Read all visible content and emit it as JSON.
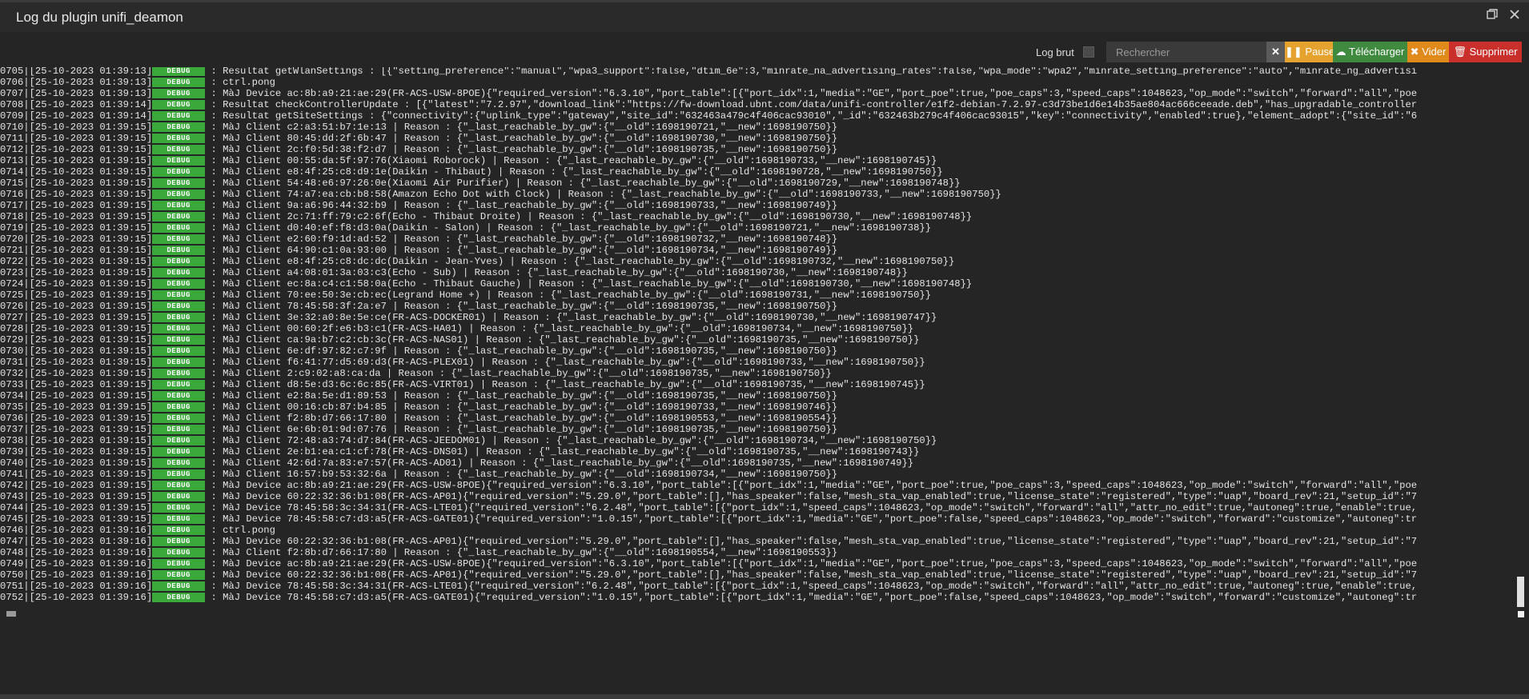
{
  "window": {
    "title": "Log du plugin unifi_deamon"
  },
  "toolbar": {
    "raw_label": "Log brut",
    "search_placeholder": "Rechercher",
    "clear_label": "✕",
    "pause_label": "Pause",
    "download_label": "Télécharger",
    "empty_label": "Vider",
    "delete_label": "Supprimer"
  },
  "colors": {
    "debug_badge": "#3ba83b",
    "pause": "#e6a22e",
    "download": "#3f8a3f",
    "empty": "#e08a1c",
    "delete": "#c9302c"
  },
  "log": {
    "lines": [
      {
        "p": "0705|[25-10-2023 01:39:13]",
        "l": "DEBUG",
        "m": " : Resultat getWlanSettings : [{\"setting_preference\":\"manual\",\"wpa3_support\":false,\"dtim_6e\":3,\"minrate_na_advertising_rates\":false,\"wpa_mode\":\"wpa2\",\"minrate_setting_preference\":\"auto\",\"minrate_ng_advertisi"
      },
      {
        "p": "0706|[25-10-2023 01:39:13]",
        "l": "DEBUG",
        "m": " : ctrl.pong"
      },
      {
        "p": "0707|[25-10-2023 01:39:13]",
        "l": "DEBUG",
        "m": " : MàJ Device ac:8b:a9:21:ae:29(FR-ACS-USW-8POE){\"required_version\":\"6.3.10\",\"port_table\":[{\"port_idx\":1,\"media\":\"GE\",\"port_poe\":true,\"poe_caps\":3,\"speed_caps\":1048623,\"op_mode\":\"switch\",\"forward\":\"all\",\"poe"
      },
      {
        "p": "0708|[25-10-2023 01:39:14]",
        "l": "DEBUG",
        "m": " : Resultat checkControllerUpdate : [{\"latest\":\"7.2.97\",\"download_link\":\"https://fw-download.ubnt.com/data/unifi-controller/e1f2-debian-7.2.97-c3d73be1d6e14b35ae804ac666ceeade.deb\",\"has_upgradable_controller"
      },
      {
        "p": "0709|[25-10-2023 01:39:14]",
        "l": "DEBUG",
        "m": " : Resultat getSiteSettings : {\"connectivity\":{\"uplink_type\":\"gateway\",\"site_id\":\"632463a479c4f406cac93010\",\"_id\":\"632463b279c4f406cac93015\",\"key\":\"connectivity\",\"enabled\":true},\"element_adopt\":{\"site_id\":\"6"
      },
      {
        "p": "0710|[25-10-2023 01:39:15]",
        "l": "DEBUG",
        "m": " : MàJ Client c2:a3:51:b7:1e:13 | Reason : {\"_last_reachable_by_gw\":{\"__old\":1698190721,\"__new\":1698190750}}"
      },
      {
        "p": "0711|[25-10-2023 01:39:15]",
        "l": "DEBUG",
        "m": " : MàJ Client 80:45:dd:2f:6b:47 | Reason : {\"_last_reachable_by_gw\":{\"__old\":1698190730,\"__new\":1698190750}}"
      },
      {
        "p": "0712|[25-10-2023 01:39:15]",
        "l": "DEBUG",
        "m": " : MàJ Client 2c:f0:5d:38:f2:d7 | Reason : {\"_last_reachable_by_gw\":{\"__old\":1698190735,\"__new\":1698190750}}"
      },
      {
        "p": "0713|[25-10-2023 01:39:15]",
        "l": "DEBUG",
        "m": " : MàJ Client 00:55:da:5f:97:76(Xiaomi Roborock) | Reason : {\"_last_reachable_by_gw\":{\"__old\":1698190733,\"__new\":1698190745}}"
      },
      {
        "p": "0714|[25-10-2023 01:39:15]",
        "l": "DEBUG",
        "m": " : MàJ Client e8:4f:25:c8:d9:1e(Daikin - Thibaut) | Reason : {\"_last_reachable_by_gw\":{\"__old\":1698190728,\"__new\":1698190750}}"
      },
      {
        "p": "0715|[25-10-2023 01:39:15]",
        "l": "DEBUG",
        "m": " : MàJ Client 54:48:e6:97:26:0e(Xiaomi Air Purifier) | Reason : {\"_last_reachable_by_gw\":{\"__old\":1698190729,\"__new\":1698190748}}"
      },
      {
        "p": "0716|[25-10-2023 01:39:15]",
        "l": "DEBUG",
        "m": " : MàJ Client 74:a7:ea:cb:b8:58(Amazon Echo Dot with Clock) | Reason : {\"_last_reachable_by_gw\":{\"__old\":1698190733,\"__new\":1698190750}}"
      },
      {
        "p": "0717|[25-10-2023 01:39:15]",
        "l": "DEBUG",
        "m": " : MàJ Client 9a:a6:96:44:32:b9 | Reason : {\"_last_reachable_by_gw\":{\"__old\":1698190733,\"__new\":1698190749}}"
      },
      {
        "p": "0718|[25-10-2023 01:39:15]",
        "l": "DEBUG",
        "m": " : MàJ Client 2c:71:ff:79:c2:6f(Echo - Thibaut Droite) | Reason : {\"_last_reachable_by_gw\":{\"__old\":1698190730,\"__new\":1698190748}}"
      },
      {
        "p": "0719|[25-10-2023 01:39:15]",
        "l": "DEBUG",
        "m": " : MàJ Client d0:40:ef:f8:d3:0a(Daikin - Salon) | Reason : {\"_last_reachable_by_gw\":{\"__old\":1698190721,\"__new\":1698190738}}"
      },
      {
        "p": "0720|[25-10-2023 01:39:15]",
        "l": "DEBUG",
        "m": " : MàJ Client e2:60:f9:1d:ad:52 | Reason : {\"_last_reachable_by_gw\":{\"__old\":1698190732,\"__new\":1698190748}}"
      },
      {
        "p": "0721|[25-10-2023 01:39:15]",
        "l": "DEBUG",
        "m": " : MàJ Client 64:90:c1:0a:93:00 | Reason : {\"_last_reachable_by_gw\":{\"__old\":1698190734,\"__new\":1698190749}}"
      },
      {
        "p": "0722|[25-10-2023 01:39:15]",
        "l": "DEBUG",
        "m": " : MàJ Client e8:4f:25:c8:dc:dc(Daikin - Jean-Yves) | Reason : {\"_last_reachable_by_gw\":{\"__old\":1698190732,\"__new\":1698190750}}"
      },
      {
        "p": "0723|[25-10-2023 01:39:15]",
        "l": "DEBUG",
        "m": " : MàJ Client a4:08:01:3a:03:c3(Echo - Sub) | Reason : {\"_last_reachable_by_gw\":{\"__old\":1698190730,\"__new\":1698190748}}"
      },
      {
        "p": "0724|[25-10-2023 01:39:15]",
        "l": "DEBUG",
        "m": " : MàJ Client ec:8a:c4:c1:58:0a(Echo - Thibaut Gauche) | Reason : {\"_last_reachable_by_gw\":{\"__old\":1698190730,\"__new\":1698190748}}"
      },
      {
        "p": "0725|[25-10-2023 01:39:15]",
        "l": "DEBUG",
        "m": " : MàJ Client 70:ee:50:3e:cb:ec(Legrand Home +) | Reason : {\"_last_reachable_by_gw\":{\"__old\":1698190731,\"__new\":1698190750}}"
      },
      {
        "p": "0726|[25-10-2023 01:39:15]",
        "l": "DEBUG",
        "m": " : MàJ Client 78:45:58:3f:2a:e7 | Reason : {\"_last_reachable_by_gw\":{\"__old\":1698190735,\"__new\":1698190750}}"
      },
      {
        "p": "0727|[25-10-2023 01:39:15]",
        "l": "DEBUG",
        "m": " : MàJ Client 3e:32:a0:8e:5e:ce(FR-ACS-DOCKER01) | Reason : {\"_last_reachable_by_gw\":{\"__old\":1698190730,\"__new\":1698190747}}"
      },
      {
        "p": "0728|[25-10-2023 01:39:15]",
        "l": "DEBUG",
        "m": " : MàJ Client 00:60:2f:e6:b3:c1(FR-ACS-HA01) | Reason : {\"_last_reachable_by_gw\":{\"__old\":1698190734,\"__new\":1698190750}}"
      },
      {
        "p": "0729|[25-10-2023 01:39:15]",
        "l": "DEBUG",
        "m": " : MàJ Client ca:9a:b7:c2:cb:3c(FR-ACS-NAS01) | Reason : {\"_last_reachable_by_gw\":{\"__old\":1698190735,\"__new\":1698190750}}"
      },
      {
        "p": "0730|[25-10-2023 01:39:15]",
        "l": "DEBUG",
        "m": " : MàJ Client 6e:df:97:82:c7:9f | Reason : {\"_last_reachable_by_gw\":{\"__old\":1698190735,\"__new\":1698190750}}"
      },
      {
        "p": "0731|[25-10-2023 01:39:15]",
        "l": "DEBUG",
        "m": " : MàJ Client f6:41:77:d5:69:d3(FR-ACS-PLEX01) | Reason : {\"_last_reachable_by_gw\":{\"__old\":1698190733,\"__new\":1698190750}}"
      },
      {
        "p": "0732|[25-10-2023 01:39:15]",
        "l": "DEBUG",
        "m": " : MàJ Client 2:c9:02:a8:ca:da | Reason : {\"_last_reachable_by_gw\":{\"__old\":1698190735,\"__new\":1698190750}}"
      },
      {
        "p": "0733|[25-10-2023 01:39:15]",
        "l": "DEBUG",
        "m": " : MàJ Client d8:5e:d3:6c:6c:85(FR-ACS-VIRT01) | Reason : {\"_last_reachable_by_gw\":{\"__old\":1698190735,\"__new\":1698190745}}"
      },
      {
        "p": "0734|[25-10-2023 01:39:15]",
        "l": "DEBUG",
        "m": " : MàJ Client e2:8a:5e:d1:89:53 | Reason : {\"_last_reachable_by_gw\":{\"__old\":1698190735,\"__new\":1698190750}}"
      },
      {
        "p": "0735|[25-10-2023 01:39:15]",
        "l": "DEBUG",
        "m": " : MàJ Client 00:16:cb:87:b4:85 | Reason : {\"_last_reachable_by_gw\":{\"__old\":1698190733,\"__new\":1698190746}}"
      },
      {
        "p": "0736|[25-10-2023 01:39:15]",
        "l": "DEBUG",
        "m": " : MàJ Client f2:8b:d7:66:17:80 | Reason : {\"_last_reachable_by_gw\":{\"__old\":1698190553,\"__new\":1698190554}}"
      },
      {
        "p": "0737|[25-10-2023 01:39:15]",
        "l": "DEBUG",
        "m": " : MàJ Client 6e:6b:01:9d:07:76 | Reason : {\"_last_reachable_by_gw\":{\"__old\":1698190735,\"__new\":1698190750}}"
      },
      {
        "p": "0738|[25-10-2023 01:39:15]",
        "l": "DEBUG",
        "m": " : MàJ Client 72:48:a3:74:d7:84(FR-ACS-JEEDOM01) | Reason : {\"_last_reachable_by_gw\":{\"__old\":1698190734,\"__new\":1698190750}}"
      },
      {
        "p": "0739|[25-10-2023 01:39:15]",
        "l": "DEBUG",
        "m": " : MàJ Client 2e:b1:ea:c1:cf:78(FR-ACS-DNS01) | Reason : {\"_last_reachable_by_gw\":{\"__old\":1698190735,\"__new\":1698190743}}"
      },
      {
        "p": "0740|[25-10-2023 01:39:15]",
        "l": "DEBUG",
        "m": " : MàJ Client 42:6d:7a:83:e7:57(FR-ACS-AD01) | Reason : {\"_last_reachable_by_gw\":{\"__old\":1698190735,\"__new\":1698190749}}"
      },
      {
        "p": "0741|[25-10-2023 01:39:15]",
        "l": "DEBUG",
        "m": " : MàJ Client 16:57:b9:53:32:6a | Reason : {\"_last_reachable_by_gw\":{\"__old\":1698190734,\"__new\":1698190750}}"
      },
      {
        "p": "0742|[25-10-2023 01:39:15]",
        "l": "DEBUG",
        "m": " : MàJ Device ac:8b:a9:21:ae:29(FR-ACS-USW-8POE){\"required_version\":\"6.3.10\",\"port_table\":[{\"port_idx\":1,\"media\":\"GE\",\"port_poe\":true,\"poe_caps\":3,\"speed_caps\":1048623,\"op_mode\":\"switch\",\"forward\":\"all\",\"poe"
      },
      {
        "p": "0743|[25-10-2023 01:39:15]",
        "l": "DEBUG",
        "m": " : MàJ Device 60:22:32:36:b1:08(FR-ACS-AP01){\"required_version\":\"5.29.0\",\"port_table\":[],\"has_speaker\":false,\"mesh_sta_vap_enabled\":true,\"license_state\":\"registered\",\"type\":\"uap\",\"board_rev\":21,\"setup_id\":\"7"
      },
      {
        "p": "0744|[25-10-2023 01:39:15]",
        "l": "DEBUG",
        "m": " : MàJ Device 78:45:58:3c:34:31(FR-ACS-LTE01){\"required_version\":\"6.2.48\",\"port_table\":[{\"port_idx\":1,\"speed_caps\":1048623,\"op_mode\":\"switch\",\"forward\":\"all\",\"attr_no_edit\":true,\"autoneg\":true,\"enable\":true,"
      },
      {
        "p": "0745|[25-10-2023 01:39:15]",
        "l": "DEBUG",
        "m": " : MàJ Device 78:45:58:c7:d3:a5(FR-ACS-GATE01){\"required_version\":\"1.0.15\",\"port_table\":[{\"port_idx\":1,\"media\":\"GE\",\"port_poe\":false,\"speed_caps\":1048623,\"op_mode\":\"switch\",\"forward\":\"customize\",\"autoneg\":tr"
      },
      {
        "p": "0746|[25-10-2023 01:39:16]",
        "l": "DEBUG",
        "m": " : ctrl.pong"
      },
      {
        "p": "0747|[25-10-2023 01:39:16]",
        "l": "DEBUG",
        "m": " : MàJ Device 60:22:32:36:b1:08(FR-ACS-AP01){\"required_version\":\"5.29.0\",\"port_table\":[],\"has_speaker\":false,\"mesh_sta_vap_enabled\":true,\"license_state\":\"registered\",\"type\":\"uap\",\"board_rev\":21,\"setup_id\":\"7"
      },
      {
        "p": "0748|[25-10-2023 01:39:16]",
        "l": "DEBUG",
        "m": " : MàJ Client f2:8b:d7:66:17:80 | Reason : {\"_last_reachable_by_gw\":{\"__old\":1698190554,\"__new\":1698190553}}"
      },
      {
        "p": "0749|[25-10-2023 01:39:16]",
        "l": "DEBUG",
        "m": " : MàJ Device ac:8b:a9:21:ae:29(FR-ACS-USW-8POE){\"required_version\":\"6.3.10\",\"port_table\":[{\"port_idx\":1,\"media\":\"GE\",\"port_poe\":true,\"poe_caps\":3,\"speed_caps\":1048623,\"op_mode\":\"switch\",\"forward\":\"all\",\"poe"
      },
      {
        "p": "0750|[25-10-2023 01:39:16]",
        "l": "DEBUG",
        "m": " : MàJ Device 60:22:32:36:b1:08(FR-ACS-AP01){\"required_version\":\"5.29.0\",\"port_table\":[],\"has_speaker\":false,\"mesh_sta_vap_enabled\":true,\"license_state\":\"registered\",\"type\":\"uap\",\"board_rev\":21,\"setup_id\":\"7"
      },
      {
        "p": "0751|[25-10-2023 01:39:16]",
        "l": "DEBUG",
        "m": " : MàJ Device 78:45:58:3c:34:31(FR-ACS-LTE01){\"required_version\":\"6.2.48\",\"port_table\":[{\"port_idx\":1,\"speed_caps\":1048623,\"op_mode\":\"switch\",\"forward\":\"all\",\"attr_no_edit\":true,\"autoneg\":true,\"enable\":true,"
      },
      {
        "p": "0752|[25-10-2023 01:39:16]",
        "l": "DEBUG",
        "m": " : MàJ Device 78:45:58:c7:d3:a5(FR-ACS-GATE01){\"required_version\":\"1.0.15\",\"port_table\":[{\"port_idx\":1,\"media\":\"GE\",\"port_poe\":false,\"speed_caps\":1048623,\"op_mode\":\"switch\",\"forward\":\"customize\",\"autoneg\":tr"
      }
    ]
  }
}
